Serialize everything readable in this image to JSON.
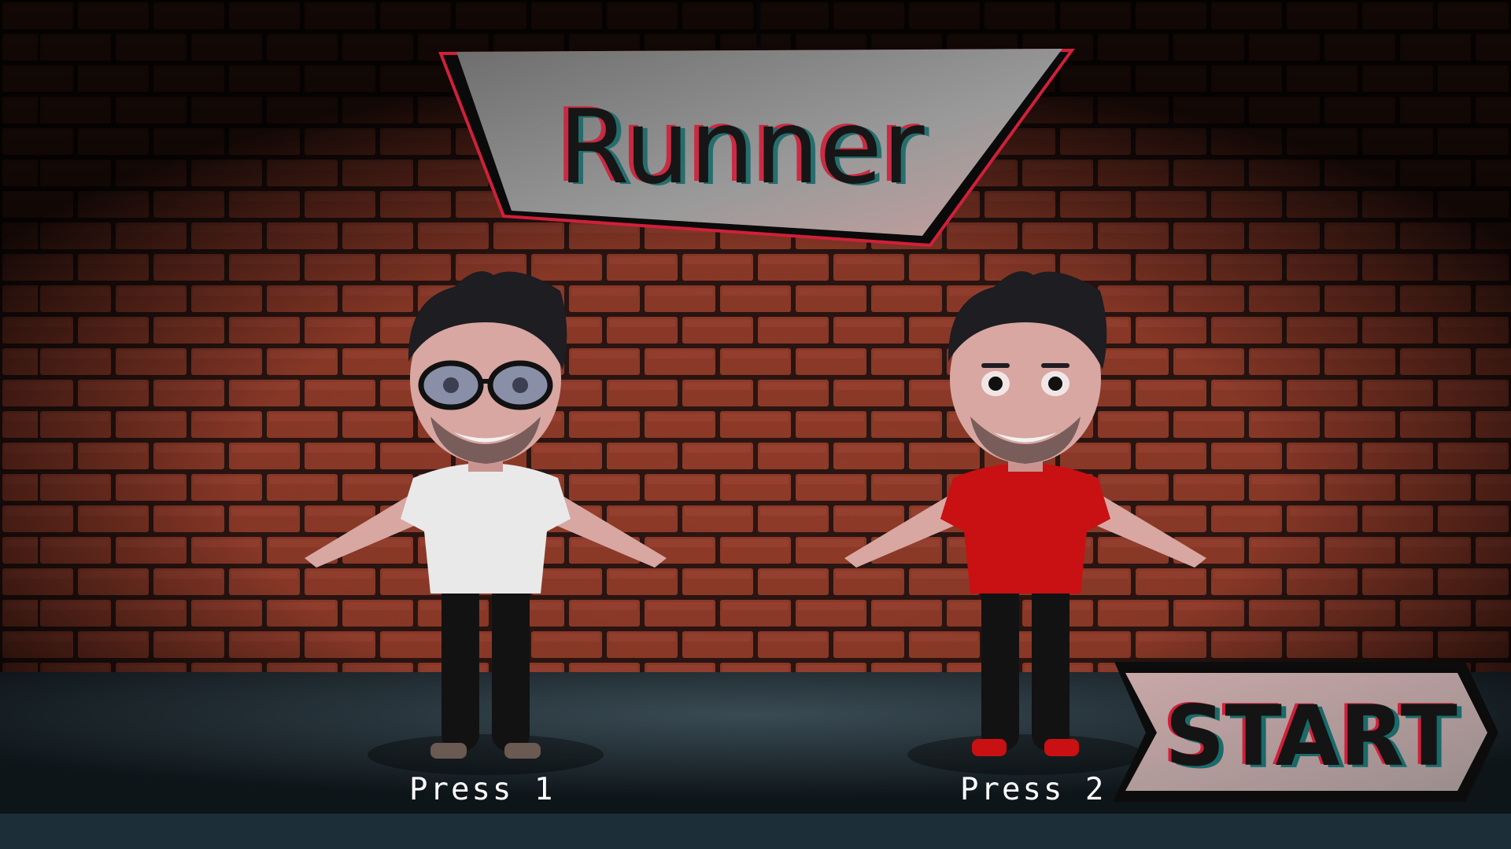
{
  "title": "Runner",
  "start_label": "START",
  "players": [
    {
      "prompt": "Press 1",
      "shirt_color": "#e9e9e9",
      "eyewear": "glasses-icon"
    },
    {
      "prompt": "Press 2",
      "shirt_color": "#c91012",
      "eyewear": "none"
    }
  ],
  "colors": {
    "brick": "#8e3a28",
    "mortar": "#2a1512",
    "floor": "#1f2b32",
    "bottom_bar": "#1c2f38",
    "sign": "#8c8c8c",
    "glitch_red": "#d0203a",
    "glitch_teal": "#1a6a6a",
    "pants": "#121212",
    "skin": "#d8a7a2",
    "hair": "#1d1d22"
  }
}
